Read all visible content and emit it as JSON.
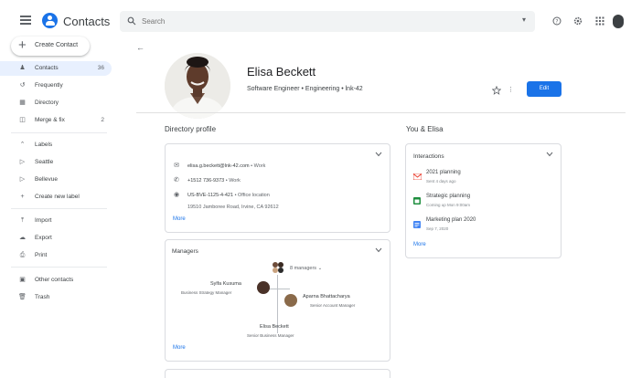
{
  "app": {
    "title": "Contacts"
  },
  "search": {
    "placeholder": "Search"
  },
  "sidebar": {
    "create_label": "Create Contact",
    "items": [
      {
        "label": "Contacts",
        "count": "36",
        "icon": "person-icon"
      },
      {
        "label": "Frequently",
        "icon": "history-icon"
      },
      {
        "label": "Directory",
        "icon": "domain-icon"
      },
      {
        "label": "Merge & fix",
        "count": "2",
        "icon": "merge-icon"
      }
    ],
    "labels_header": "Labels",
    "labels": [
      {
        "label": "Seattle"
      },
      {
        "label": "Bellevue"
      },
      {
        "label": "Create new label"
      }
    ],
    "tools": [
      {
        "label": "Import"
      },
      {
        "label": "Export"
      },
      {
        "label": "Print"
      }
    ],
    "other": [
      {
        "label": "Other contacts"
      },
      {
        "label": "Trash"
      }
    ]
  },
  "contact": {
    "name": "Elisa Beckett",
    "subtitle": "Software Engineer • Engineering • lnk-42",
    "edit_label": "Edit"
  },
  "directory": {
    "title": "Directory profile",
    "email": "elisa.g.beckett@lnk-42.com",
    "email_type": " • Work",
    "phone": "+1512 736-9373",
    "phone_type": " • Work",
    "location": "US-BVE-1125-4-421",
    "location_type": " • Office location",
    "address": "19510 Jamboree Road, Irvine, CA 92612",
    "more": "More"
  },
  "managers": {
    "title": "Managers",
    "count_label": "8 managers",
    "people": [
      {
        "name": "Sylfa Kusuma",
        "role": "Business Strategy Manager"
      },
      {
        "name": "Aparna Bhattacharya",
        "role": "Senior Account Manager"
      },
      {
        "name": "Elisa Beckett",
        "role": "Senior Business Manager"
      }
    ],
    "more": "More"
  },
  "you_and": {
    "title": "You & Elisa",
    "interactions_title": "Interactions",
    "items": [
      {
        "title": "2021 planning",
        "sub": "Sent 4 days ago",
        "icon": "gmail-icon"
      },
      {
        "title": "Strategic planning",
        "sub": "Coming up Mon 9:00am",
        "icon": "calendar-icon"
      },
      {
        "title": "Marketing plan 2020",
        "sub": "Sep 7, 2020",
        "icon": "docs-icon"
      }
    ],
    "more": "More"
  },
  "colors": {
    "accent": "#1a73e8",
    "active_nav": "#e8f0fe"
  }
}
